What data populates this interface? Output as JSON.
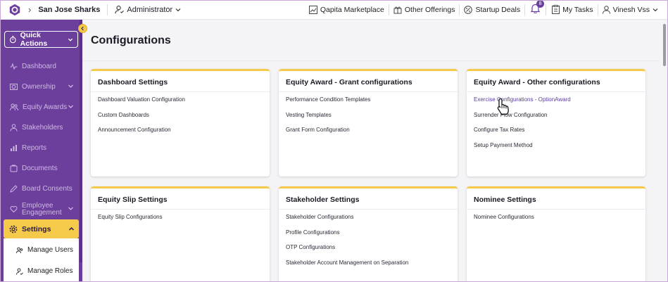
{
  "topbar": {
    "org": "San Jose Sharks",
    "role": "Administrator",
    "items": [
      {
        "label": "Qapita Marketplace",
        "icon": "chart-icon"
      },
      {
        "label": "Other Offerings",
        "icon": "gift-icon"
      },
      {
        "label": "Startup Deals",
        "icon": "percent-icon"
      }
    ],
    "notif_count": "8",
    "tasks": "My Tasks",
    "user": "Vinesh Vss"
  },
  "sidebar": {
    "quick_actions": "Quick Actions",
    "items": [
      {
        "label": "Dashboard",
        "icon": "pulse-icon"
      },
      {
        "label": "Ownership",
        "icon": "pie-icon",
        "chevron": true
      },
      {
        "label": "Equity Awards",
        "icon": "people-icon",
        "chevron": true
      },
      {
        "label": "Stakeholders",
        "icon": "person-icon"
      },
      {
        "label": "Reports",
        "icon": "bar-icon"
      },
      {
        "label": "Documents",
        "icon": "doc-icon"
      },
      {
        "label": "Board Consents",
        "icon": "pen-icon"
      },
      {
        "label_line1": "Employee",
        "label_line2": "Engagement",
        "icon": "heart-icon",
        "chevron": true
      }
    ],
    "settings": "Settings",
    "sub_items": [
      "Manage Users",
      "Manage Roles"
    ]
  },
  "main": {
    "title": "Configurations",
    "cards": [
      {
        "title": "Dashboard Settings",
        "links": [
          "Dashboard Valuation Configuration",
          "Custom Dashboards",
          "Announcement Configuration"
        ]
      },
      {
        "title": "Equity Award - Grant configurations",
        "links": [
          "Performance Condition Templates",
          "Vesting Templates",
          "Grant Form Configuration"
        ]
      },
      {
        "title": "Equity Award - Other configurations",
        "links": [
          "Exercise Configurations - OptionAward",
          "Surrender Flow Configuration",
          "Configure Tax Rates",
          "Setup Payment Method"
        ]
      },
      {
        "title": "Equity Slip Settings",
        "links": [
          "Equity Slip Configurations"
        ]
      },
      {
        "title": "Stakeholder Settings",
        "links": [
          "Stakeholder Configurations",
          "Profile Configurations",
          "OTP Configurations",
          "Stakeholder Account Management on Separation"
        ]
      },
      {
        "title": "Nominee Settings",
        "links": [
          "Nominee Configurations"
        ]
      }
    ]
  },
  "colors": {
    "brand": "#6d3f9d",
    "accent": "#f5c94a"
  }
}
